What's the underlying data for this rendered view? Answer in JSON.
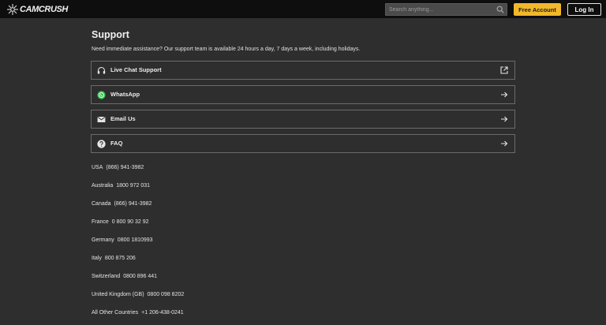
{
  "header": {
    "logo_text": "CAMCRUSH",
    "search_placeholder": "Search anything...",
    "free_account_label": "Free Account",
    "login_label": "Log In"
  },
  "colors": {
    "accent": "#f2b82a",
    "background": "#2e2e2e",
    "topbar": "#0e0e0e"
  },
  "support": {
    "title": "Support",
    "intro": "Need immediate assistance? Our support team is available 24 hours a day, 7 days a week, including holidays.",
    "options": [
      {
        "label": "Live Chat Support",
        "icon": "headset-icon",
        "trail": "external-link-icon"
      },
      {
        "label": "WhatsApp",
        "icon": "whatsapp-icon",
        "trail": "arrow-right-icon"
      },
      {
        "label": "Email Us",
        "icon": "mail-icon",
        "trail": "arrow-right-icon"
      },
      {
        "label": "FAQ",
        "icon": "question-icon",
        "trail": "arrow-right-icon"
      }
    ],
    "phones": [
      {
        "country": "USA",
        "number": "(866) 941-3982"
      },
      {
        "country": "Australia",
        "number": "1800 972 031"
      },
      {
        "country": "Canada",
        "number": "(866) 941-3982"
      },
      {
        "country": "France",
        "number": "0 800 90 32 92"
      },
      {
        "country": "Germany",
        "number": "0800 1810993"
      },
      {
        "country": "Italy",
        "number": "800 875 206"
      },
      {
        "country": "Switzerland",
        "number": "0800 896 441"
      },
      {
        "country": "United Kingdom (GB)",
        "number": "0800 098 8202"
      },
      {
        "country": "All Other Countries",
        "number": "+1 206-438-0241"
      }
    ]
  }
}
